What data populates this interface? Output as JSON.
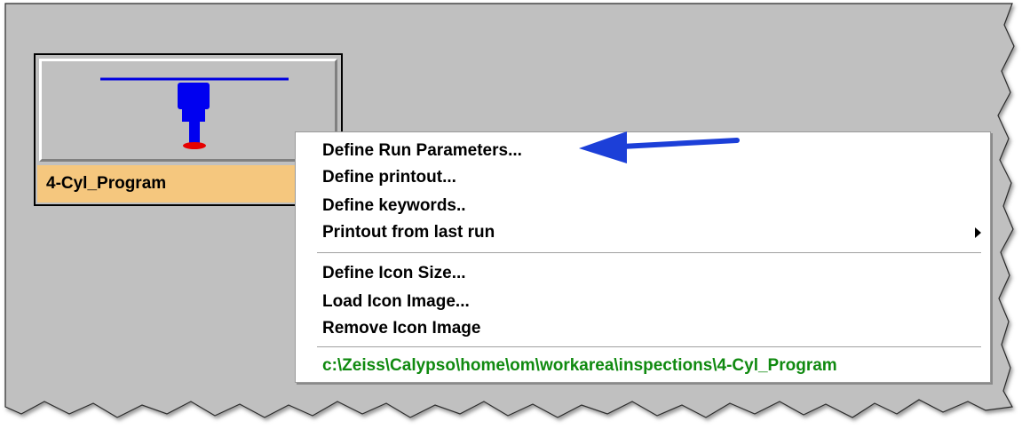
{
  "program": {
    "name": "4-Cyl_Program",
    "label_color": "#f5c77e"
  },
  "context_menu": {
    "items": [
      {
        "label": "Define Run Parameters...",
        "has_submenu": false
      },
      {
        "label": "Define printout...",
        "has_submenu": false
      },
      {
        "label": "Define keywords..",
        "has_submenu": false
      },
      {
        "label": "Printout from last run",
        "has_submenu": true
      },
      {
        "label": "Define Icon Size...",
        "has_submenu": false
      },
      {
        "label": "Load Icon Image...",
        "has_submenu": false
      },
      {
        "label": "Remove Icon Image",
        "has_submenu": false
      }
    ],
    "path": "c:\\Zeiss\\Calypso\\home\\om\\workarea\\inspections\\4-Cyl_Program",
    "path_color": "#108a10"
  },
  "annotation": {
    "arrow_color": "#1c3fd8",
    "target_item": "Define Run Parameters..."
  },
  "background_color": "#c0c0c0"
}
